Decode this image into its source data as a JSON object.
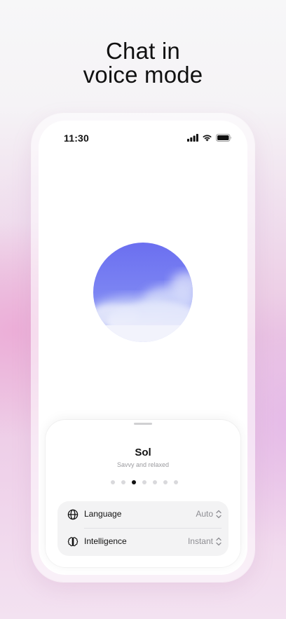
{
  "headline": {
    "line1": "Chat in",
    "line2": "voice mode"
  },
  "status_bar": {
    "time": "11:30",
    "icons": [
      "cellular-signal-icon",
      "wifi-icon",
      "battery-icon"
    ]
  },
  "orb": {
    "icon": "voice-orb",
    "colors": {
      "sky": "#6f74f2",
      "cloud": "#eef0fb"
    }
  },
  "voice_sheet": {
    "voice_name": "Sol",
    "voice_description": "Savvy and relaxed",
    "pagination": {
      "total": 7,
      "active_index": 2
    },
    "settings": [
      {
        "icon": "globe-icon",
        "label": "Language",
        "value": "Auto"
      },
      {
        "icon": "brain-icon",
        "label": "Intelligence",
        "value": "Instant"
      }
    ]
  },
  "colors": {
    "text_primary": "#111111",
    "text_secondary": "#8e8e93",
    "card_background": "#f3f3f4"
  }
}
